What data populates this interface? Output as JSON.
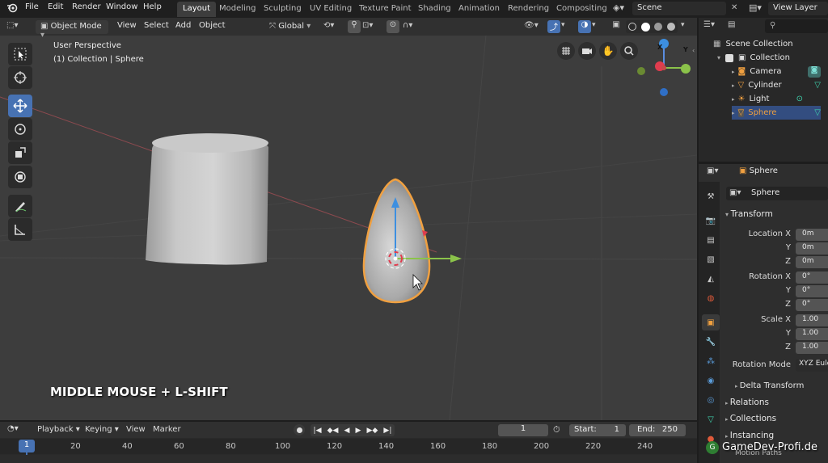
{
  "menubar": {
    "items": [
      "File",
      "Edit",
      "Render",
      "Window",
      "Help"
    ],
    "workspaces": [
      "Layout",
      "Modeling",
      "Sculpting",
      "UV Editing",
      "Texture Paint",
      "Shading",
      "Animation",
      "Rendering",
      "Compositing"
    ],
    "active_workspace": "Layout",
    "scene": "Scene",
    "view_layer": "View Layer"
  },
  "viewport_header": {
    "mode": "Object Mode",
    "menus": [
      "View",
      "Select",
      "Add",
      "Object"
    ],
    "orientation": "Global"
  },
  "viewport": {
    "perspective": "User Perspective",
    "collection_info": "(1) Collection | Sphere",
    "overlay_caption": "MIDDLE MOUSE + L-SHIFT",
    "gizmo_axes": {
      "x": "X",
      "y": "Y",
      "z": "Z"
    }
  },
  "outliner": {
    "root": "Scene Collection",
    "collection": "Collection",
    "objects": [
      {
        "name": "Camera",
        "icon": "camera-icon",
        "color": "#e6e6e6"
      },
      {
        "name": "Cylinder",
        "icon": "mesh-icon",
        "color": "#e6e6e6"
      },
      {
        "name": "Light",
        "icon": "light-icon",
        "color": "#e6e6e6"
      },
      {
        "name": "Sphere",
        "icon": "mesh-icon",
        "color": "#f0a040"
      }
    ]
  },
  "properties": {
    "header_object": "Sphere",
    "object_name": "Sphere",
    "transform_title": "Transform",
    "rows": [
      {
        "label": "Location X",
        "value": "0m"
      },
      {
        "label": "Y",
        "value": "0m"
      },
      {
        "label": "Z",
        "value": "0m"
      },
      {
        "label": "Rotation X",
        "value": "0°"
      },
      {
        "label": "Y",
        "value": "0°"
      },
      {
        "label": "Z",
        "value": "0°"
      },
      {
        "label": "Scale X",
        "value": "1.00"
      },
      {
        "label": "Y",
        "value": "1.00"
      },
      {
        "label": "Z",
        "value": "1.00"
      }
    ],
    "rotation_mode_label": "Rotation Mode",
    "rotation_mode_value": "XYZ Eule",
    "panels": [
      "Delta Transform",
      "Relations",
      "Collections",
      "Instancing",
      "Motion Paths"
    ]
  },
  "timeline": {
    "menus": [
      "Playback",
      "Keying",
      "View",
      "Marker"
    ],
    "current_frame": "1",
    "start_label": "Start:",
    "start_value": "1",
    "end_label": "End:",
    "end_value": "250",
    "ruler": [
      "1",
      "20",
      "40",
      "60",
      "80",
      "100",
      "120",
      "140",
      "160",
      "180",
      "200",
      "220",
      "240"
    ]
  },
  "watermark": "GameDev-Profi.de",
  "colors": {
    "accent": "#4772b3",
    "selection": "#f0a040",
    "axis_x": "#e03c4e",
    "axis_y": "#8bc34a",
    "axis_z": "#3d8fe0"
  }
}
